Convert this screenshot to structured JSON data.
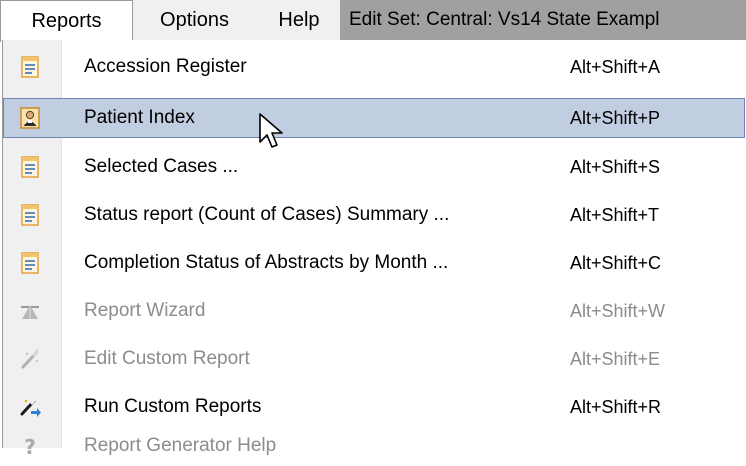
{
  "menubar": {
    "items": [
      {
        "label": "Reports"
      },
      {
        "label": "Options"
      },
      {
        "label": "Help"
      }
    ],
    "edit_set": "Edit Set: Central: Vs14 State Exampl"
  },
  "reports_menu": {
    "items": [
      {
        "label": "Accession Register",
        "shortcut": "Alt+Shift+A",
        "icon": "report-icon",
        "enabled": true
      },
      {
        "label": "Patient Index",
        "shortcut": "Alt+Shift+P",
        "icon": "patient-index-icon",
        "enabled": true,
        "highlighted": true
      },
      {
        "label": "Selected Cases ...",
        "shortcut": "Alt+Shift+S",
        "icon": "report-icon",
        "enabled": true
      },
      {
        "label": "Status report (Count of Cases) Summary ...",
        "shortcut": "Alt+Shift+T",
        "icon": "report-icon",
        "enabled": true
      },
      {
        "label": "Completion Status of Abstracts by Month ...",
        "shortcut": "Alt+Shift+C",
        "icon": "report-icon",
        "enabled": true
      },
      {
        "label": "Report Wizard",
        "shortcut": "Alt+Shift+W",
        "icon": "wizard-icon",
        "enabled": false
      },
      {
        "label": "Edit Custom Report",
        "shortcut": "Alt+Shift+E",
        "icon": "magic-wand-icon",
        "enabled": false
      },
      {
        "label": "Run Custom Reports",
        "shortcut": "Alt+Shift+R",
        "icon": "magic-wand-run-icon",
        "enabled": true
      },
      {
        "label": "Report Generator Help",
        "shortcut": "",
        "icon": "help-icon",
        "enabled": false
      }
    ]
  },
  "colors": {
    "highlight_bg": "#c1cde0",
    "highlight_border": "#6f87b0",
    "disabled_text": "#8c8c8c",
    "edit_set_bg": "#a0a0a0"
  }
}
